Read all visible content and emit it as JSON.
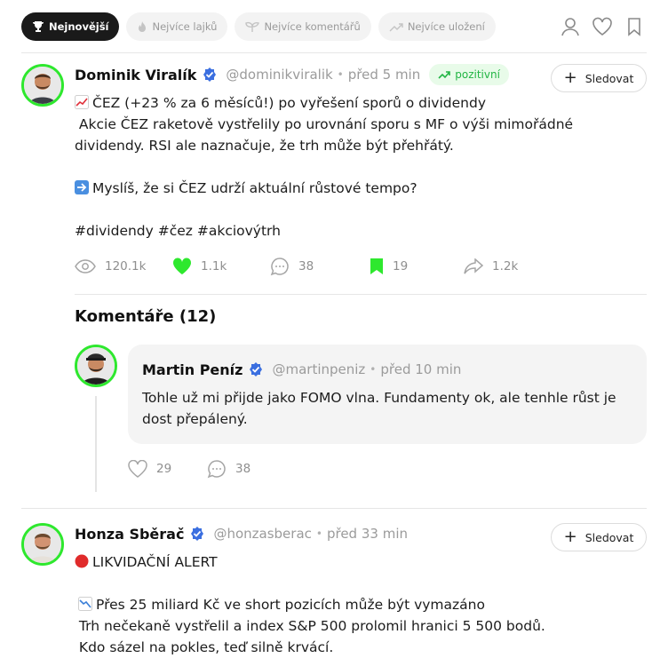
{
  "filters": [
    {
      "label": "Nejnovější",
      "icon": "trophy-icon",
      "active": true
    },
    {
      "label": "Nejvíce lajků",
      "icon": "fire-icon",
      "active": false
    },
    {
      "label": "Nejvíce komentářů",
      "icon": "sprout-icon",
      "active": false
    },
    {
      "label": "Nejvíce uložení",
      "icon": "trend-up-icon",
      "active": false
    }
  ],
  "header_icons": [
    "user-icon",
    "heart-icon",
    "bookmark-icon"
  ],
  "post1": {
    "author": "Dominik Viralík",
    "handle": "@dominikviralik",
    "time": "před 5 min",
    "sentiment": "pozitivní",
    "follow_label": "Sledovat",
    "lines": [
      "ČEZ (+23 % za 6 měsíců!) po vyřešení sporů o dividendy",
      " Akcie ČEZ raketově vystřelily po urovnání sporu s MF o výši mimořádné",
      "dividendy. RSI ale naznačuje, že trh může být přehřátý.",
      "Myslíš, že si ČEZ udrží aktuální růstové tempo?",
      "#dividendy #čez #akciovýtrh"
    ],
    "stats": {
      "views": "120.1k",
      "likes": "1.1k",
      "comments": "38",
      "saves": "19",
      "shares": "1.2k"
    }
  },
  "comments": {
    "title": "Komentáře (12)",
    "items": [
      {
        "author": "Martin Peníz",
        "handle": "@martinpeniz",
        "time": "před 10 min",
        "lines": [
          "Tohle už mi přijde jako FOMO vlna. Fundamenty ok, ale tenhle růst je",
          "dost přepálený."
        ],
        "likes": "29",
        "replies": "38"
      }
    ]
  },
  "post2": {
    "author": "Honza Sběrač",
    "handle": "@honzasberac",
    "time": "před 33 min",
    "follow_label": "Sledovat",
    "lines": [
      "LIKVIDAČNÍ ALERT",
      "Přes 25 miliard Kč ve short pozicích může být vymazáno",
      " Trh nečekaně vystřelil a index S&P 500 prolomil hranici 5 500 bodů.",
      " Kdo sázel na pokles, teď silně krvácí."
    ]
  },
  "colors": {
    "accent_green": "#2ee82e",
    "verified_blue": "#3b6fe0",
    "badge_green": "#22b544"
  }
}
